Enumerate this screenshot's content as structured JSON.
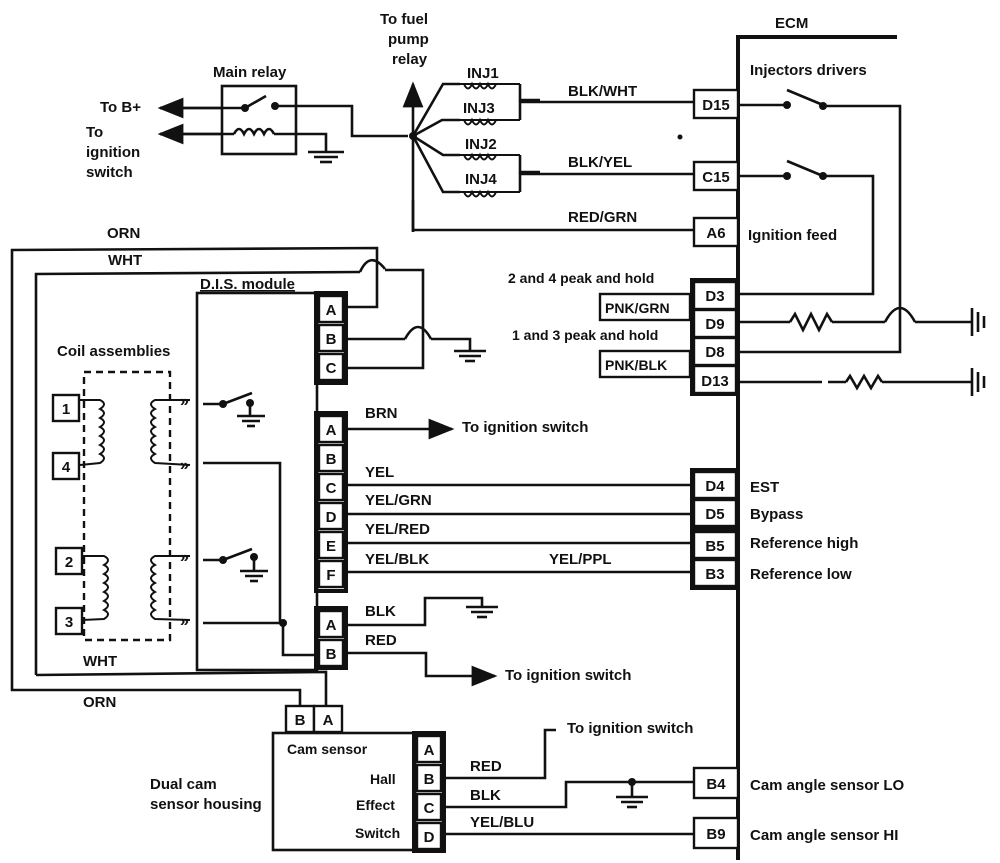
{
  "diagram": {
    "type": "automotive wiring schematic",
    "ecm": {
      "label": "ECM",
      "injectors_label": "Injectors drivers",
      "pins": {
        "D15": "D15",
        "C15": "C15",
        "A6": "A6",
        "D3": "D3",
        "D9": "D9",
        "D8": "D8",
        "D13": "D13",
        "D4": "D4",
        "D5": "D5",
        "B5": "B5",
        "B3": "B3",
        "B4": "B4",
        "B9": "B9"
      },
      "functions": {
        "A6": "Ignition feed",
        "D3": "2 and 4 peak and hold",
        "D8": "1 and 3 peak and hold",
        "D4": "EST",
        "D5": "Bypass",
        "B5": "Reference high",
        "B3": "Reference low",
        "B4": "Cam angle sensor LO",
        "B9": "Cam angle sensor HI"
      }
    },
    "main_relay": {
      "label": "Main relay",
      "to_bplus": "To B+",
      "to_ignition": [
        "To",
        "ignition",
        "switch"
      ]
    },
    "fuel_pump": [
      "To fuel",
      "pump",
      "relay"
    ],
    "injectors": [
      "INJ1",
      "INJ3",
      "INJ2",
      "INJ4"
    ],
    "wires": {
      "blk_wht": "BLK/WHT",
      "blk_yel": "BLK/YEL",
      "red_grn": "RED/GRN",
      "orn": "ORN",
      "wht": "WHT",
      "pnk_grn": "PNK/GRN",
      "pnk_blk": "PNK/BLK",
      "brn": "BRN",
      "yel": "YEL",
      "yel_grn": "YEL/GRN",
      "yel_red": "YEL/RED",
      "yel_blk": "YEL/BLK",
      "yel_ppl": "YEL/PPL",
      "blk": "BLK",
      "red": "RED",
      "wht_bottom": "WHT",
      "orn_bottom": "ORN",
      "cam_red": "RED",
      "cam_blk": "BLK",
      "yel_blu": "YEL/BLU"
    },
    "dis_module": {
      "label": "D.I.S. module",
      "conn1": [
        "A",
        "B",
        "C"
      ],
      "conn2": [
        "A",
        "B",
        "C",
        "D",
        "E",
        "F"
      ],
      "conn3": [
        "A",
        "B"
      ]
    },
    "coil_assemblies": {
      "label": "Coil assemblies",
      "terminals": [
        "1",
        "4",
        "2",
        "3"
      ]
    },
    "cam_sensor": {
      "label": "Cam sensor",
      "housing_label": [
        "Dual cam",
        "sensor housing"
      ],
      "pin_labels": [
        "Hall",
        "Effect",
        "Switch"
      ],
      "pins": [
        "A",
        "B",
        "C",
        "D"
      ],
      "top_pins": [
        "B",
        "A"
      ]
    },
    "destinations": {
      "to_ignition_1": "To ignition switch",
      "to_ignition_2": "To ignition switch",
      "to_ignition_3": "To ignition switch"
    }
  }
}
